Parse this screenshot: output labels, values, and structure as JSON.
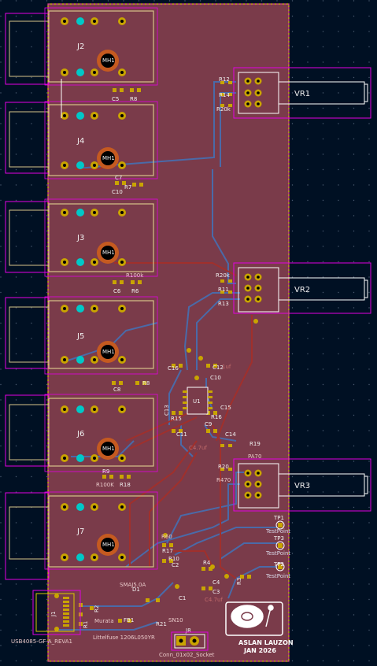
{
  "colors": {
    "background": "#001023",
    "board_fill": "#7a3b4a",
    "board_edge": "#d9c900",
    "courtyard": "#e300e3",
    "fab": "#d7c38a",
    "pad_gold": "#c9a400",
    "pad_cyan": "#00c8c8",
    "trace_front": "#a0302c",
    "trace_back": "#4a6aa8"
  },
  "jacks": [
    {
      "ref": "J2",
      "hole": "MH1"
    },
    {
      "ref": "J4",
      "hole": "MH1"
    },
    {
      "ref": "J3",
      "hole": "MH1"
    },
    {
      "ref": "J5",
      "hole": "MH1"
    },
    {
      "ref": "J6",
      "hole": "MH1"
    },
    {
      "ref": "J7",
      "hole": "MH1"
    }
  ],
  "pots": [
    {
      "ref": "VR1"
    },
    {
      "ref": "VR2"
    },
    {
      "ref": "VR3"
    }
  ],
  "refs": {
    "r12": "R12",
    "r14": "R14",
    "r20k": "R20k",
    "c5": "C5",
    "r8a": "R8",
    "c7": "C7",
    "r7": "R7",
    "c10b": "C10",
    "c6": "C6",
    "r6": "R6",
    "r100k": "R100k",
    "r20kb": "R20k",
    "r11": "R11",
    "r13": "R13",
    "c16": "C16",
    "c12": "C12",
    "c10": "C10",
    "c1uf": "1uf",
    "c8": "C8",
    "r8": "R8",
    "c13": "C13",
    "c15": "C15",
    "r15": "R15",
    "r16": "R16",
    "c9": "C9",
    "c11": "C11",
    "c14": "C14",
    "c47uf": "C4.7uf",
    "r19": "R19",
    "pa70": "PA70",
    "r20": "R20",
    "r470": "R470",
    "r9": "R9",
    "r100ka": "R100K",
    "r18": "R18",
    "r60": "R60",
    "r17": "R17",
    "r10": "R10",
    "c2": "C2",
    "r4": "R4",
    "c4": "C4",
    "c3": "C3",
    "c47uf_b": "C4.7uf",
    "r3": "R3",
    "u1": "U1",
    "d1": "D1",
    "smaj": "SMAJ5.0A",
    "fb1": "FB1",
    "r21": "R21",
    "sn10": "SN10",
    "c1": "C1",
    "j1": "J1",
    "r2": "R2",
    "r1": "R1",
    "j8": "J8",
    "murata": "Murata",
    "littelfuse": "Littelfuse 1206L050YR"
  },
  "testpoints": [
    {
      "ref": "TP1",
      "label": "TestPoint"
    },
    {
      "ref": "TP3",
      "label": "TestPoint"
    },
    {
      "ref": "TP2",
      "label": "TestPoint"
    }
  ],
  "usb_label": "USB4085-GF-A_REVA1",
  "socket_label": "Conn_01x02_Socket",
  "author": "ASLAN LAUZON",
  "date": "JAN 2026"
}
